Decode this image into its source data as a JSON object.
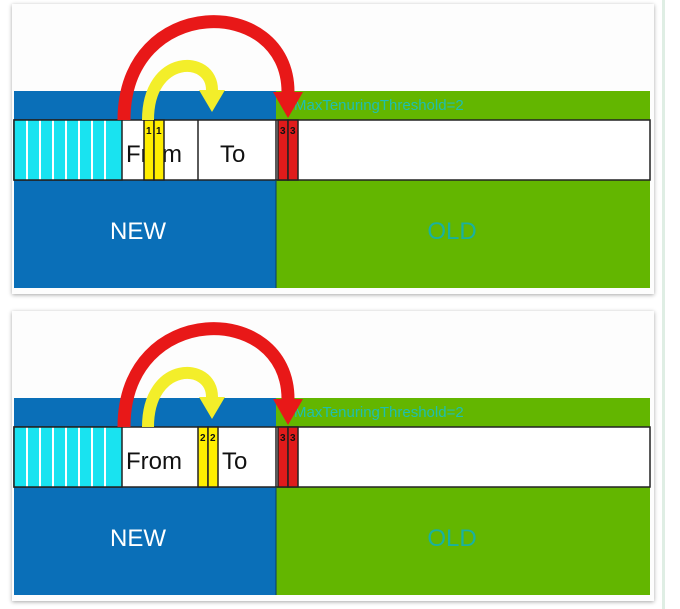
{
  "panels": [
    {
      "new_label": "NEW",
      "old_label": "OLD",
      "threshold_label": "MaxTenuringThreshold=2",
      "from_label": "From",
      "to_label": "To",
      "yellow_ages": [
        "1",
        "1"
      ],
      "red_ages": [
        "3",
        "3"
      ]
    },
    {
      "new_label": "NEW",
      "old_label": "OLD",
      "threshold_label": "MaxTenuringThreshold=2",
      "from_label": "From",
      "to_label": "To",
      "yellow_ages": [
        "2",
        "2"
      ],
      "red_ages": [
        "3",
        "3"
      ]
    }
  ],
  "colors": {
    "young_generation": "#0a6fb8",
    "old_generation": "#63b600",
    "eden_stripes": "#19e3f0",
    "survivor_object": "#ffee00",
    "promoted_object": "#e01b1b",
    "arrow_promote": "#e81818",
    "arrow_survive": "#f3ee2a"
  }
}
